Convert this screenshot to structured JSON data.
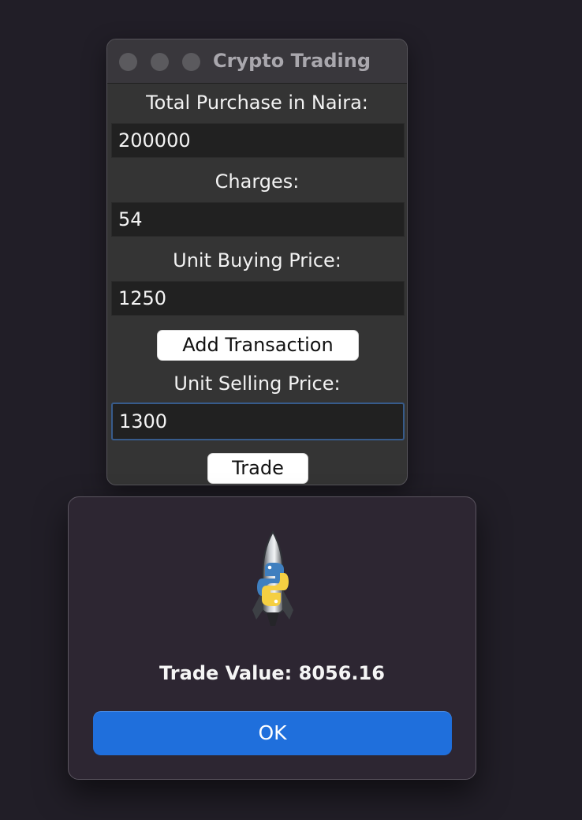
{
  "window": {
    "title": "Crypto Trading"
  },
  "form": {
    "total_purchase_label": "Total Purchase in Naira:",
    "total_purchase_value": "200000",
    "charges_label": "Charges:",
    "charges_value": "54",
    "unit_buying_price_label": "Unit Buying Price:",
    "unit_buying_price_value": "1250",
    "add_transaction_label": "Add Transaction",
    "unit_selling_price_label": "Unit Selling Price:",
    "unit_selling_price_value": "1300",
    "trade_label": "Trade"
  },
  "dialog": {
    "icon": "python-rocket-icon",
    "message": "Trade Value: 8056.16",
    "ok_label": "OK"
  },
  "colors": {
    "desktop_background": "#211e27",
    "window_background": "#343434",
    "entry_background": "#212121",
    "focus_border": "#375b8b",
    "dialog_background": "#2d2632",
    "primary_button": "#1f6fdc"
  }
}
